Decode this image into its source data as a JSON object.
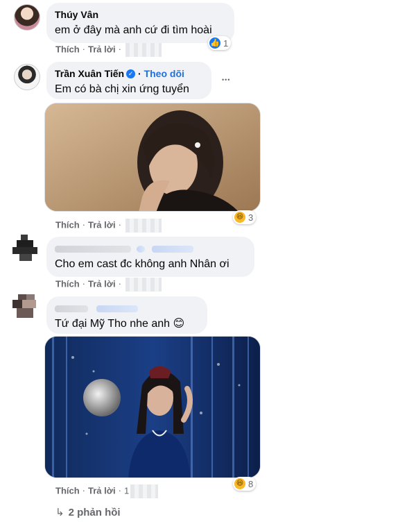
{
  "comments": [
    {
      "author": "Thúy Vân",
      "text": "em ở đây mà anh cứ đi tìm hoài",
      "actions": {
        "like": "Thích",
        "reply": "Trả lời"
      },
      "reaction": {
        "icon": "like-icon",
        "count": "1"
      }
    },
    {
      "author": "Trần Xuân Tiến",
      "verified": true,
      "follow": "Theo dõi",
      "text": "Em có bà chị xin ứng tuyển",
      "more": "•••",
      "actions": {
        "like": "Thích",
        "reply": "Trả lời"
      },
      "reaction": {
        "icon": "haha-icon",
        "count": "3"
      }
    },
    {
      "author_blurred": true,
      "text": "Cho em cast đc không anh Nhân ơi",
      "actions": {
        "like": "Thích",
        "reply": "Trả lời"
      }
    },
    {
      "author_blurred": true,
      "text": "Tứ đại Mỹ Tho nhe anh 😊",
      "actions": {
        "like": "Thích",
        "reply": "Trả lời",
        "time_partial": "1"
      },
      "reaction": {
        "icon": "haha-icon",
        "count": "8"
      }
    }
  ],
  "replies_link": "2 phản hồi",
  "colors": {
    "bubble": "#f0f2f5",
    "meta_text": "#65676b",
    "link_blue": "#216fdb",
    "like_blue": "#1877f2",
    "haha_yellow": "#f7b928"
  }
}
